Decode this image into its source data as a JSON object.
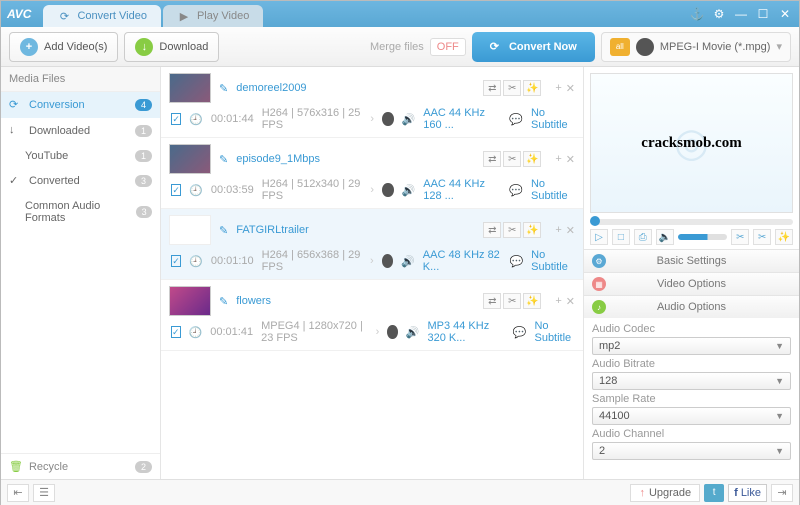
{
  "app": {
    "name": "AVC"
  },
  "tabs": {
    "convert": "Convert Video",
    "play": "Play Video"
  },
  "toolbar": {
    "add": "Add Video(s)",
    "download": "Download",
    "merge": "Merge files",
    "merge_state": "OFF",
    "convert": "Convert Now"
  },
  "profile": {
    "label": "MPEG-I Movie (*.mpg)"
  },
  "sidebar": {
    "title": "Media Files",
    "items": [
      {
        "label": "Conversion",
        "count": "4",
        "active": true
      },
      {
        "label": "Downloaded",
        "count": "1"
      },
      {
        "label": "YouTube",
        "count": "1"
      },
      {
        "label": "Converted",
        "count": "3"
      },
      {
        "label": "Common Audio Formats",
        "count": "3"
      }
    ],
    "recycle": "Recycle",
    "recycle_count": "2"
  },
  "files": [
    {
      "name": "demoreel2009",
      "duration": "00:01:44",
      "video": "H264 | 576x316 | 25 FPS",
      "audio": "AAC 44 KHz 160 ...",
      "sub": "No Subtitle"
    },
    {
      "name": "episode9_1Mbps",
      "duration": "00:03:59",
      "video": "H264 | 512x340 | 29 FPS",
      "audio": "AAC 44 KHz 128 ...",
      "sub": "No Subtitle"
    },
    {
      "name": "FATGIRLtrailer",
      "duration": "00:01:10",
      "video": "H264 | 656x368 | 29 FPS",
      "audio": "AAC 48 KHz 82 K...",
      "sub": "No Subtitle",
      "sel": true
    },
    {
      "name": "flowers",
      "duration": "00:01:41",
      "video": "MPEG4 | 1280x720 | 23 FPS",
      "audio": "MP3 44 KHz 320 K...",
      "sub": "No Subtitle"
    }
  ],
  "watermark": "cracksmob.com",
  "settings": {
    "basic": "Basic Settings",
    "video": "Video Options",
    "audio": "Audio Options",
    "fields": {
      "codec_label": "Audio Codec",
      "codec": "mp2",
      "bitrate_label": "Audio Bitrate",
      "bitrate": "128",
      "sample_label": "Sample Rate",
      "sample": "44100",
      "channel_label": "Audio Channel",
      "channel": "2"
    }
  },
  "footer": {
    "upgrade": "Upgrade",
    "like": "Like"
  }
}
